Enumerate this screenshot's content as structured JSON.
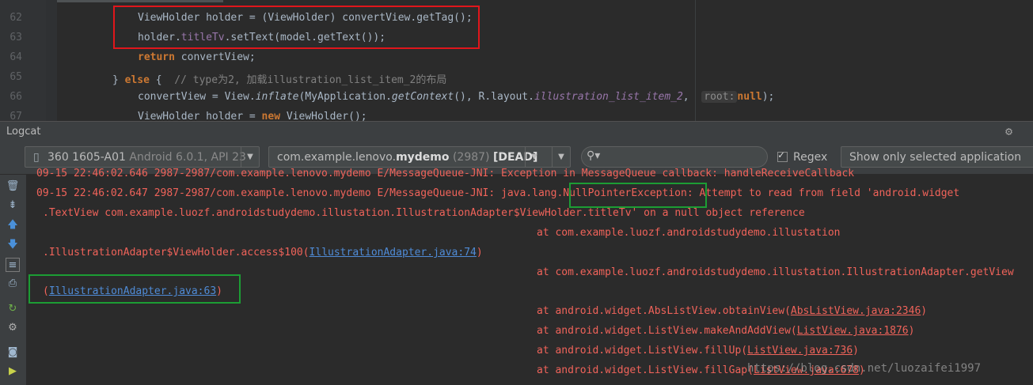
{
  "editor": {
    "lines": [
      {
        "num": "62",
        "code": "ViewHolder holder = (ViewHolder) convertView.getTag();"
      },
      {
        "num": "63",
        "pre": "holder.",
        "field": "titleTv",
        "post": ".setText(model.getText());"
      },
      {
        "num": "64",
        "kw": "return",
        "post": " convertView;"
      },
      {
        "num": "65",
        "pre": "} ",
        "kw": "else",
        "post": " {  ",
        "comment": "// type为2, 加载illustration_list_item_2的布局"
      },
      {
        "num": "66",
        "pre": "convertView = View.",
        "italic": "inflate",
        "mid": "(MyApplication.",
        "italic2": "getContext",
        "mid2": "(), R.layout.",
        "field_italic": "illustration_list_item_2",
        "mid3": ",  ",
        "hint": "root:",
        "kw": "null",
        "post": ");"
      },
      {
        "num": "67",
        "pre": "ViewHolder holder = ",
        "kw": "new",
        "post": " ViewHolder();"
      }
    ]
  },
  "logcat": {
    "title": "Logcat",
    "device": {
      "name": "360 1605-A01",
      "detail": " Android 6.0.1, API 23"
    },
    "process": {
      "prefix": "com.example.lenovo.",
      "bold": "mydemo",
      "pid": " (2987) ",
      "state": "[DEAD]"
    },
    "search": {
      "value": ""
    },
    "regex_label": "Regex",
    "filter": "Show only selected application"
  },
  "log": {
    "line0": "09-15 22:46:02.646 2987-2987/com.example.lenovo.mydemo E/MessageQueue-JNI: Exception in MessageQueue callback: handleReceiveCallback",
    "line1_pre": "09-15 22:46:02.647 2987-2987/com.example.lenovo.mydemo E/MessageQueue-JNI: java.lang.",
    "line1_exc": "NullPointerException",
    "line1_post": ": Attempt to read from field 'android.widget",
    "line2": ".TextView com.example.luozf.androidstudydemo.illustation.IllustrationAdapter$ViewHolder.titleTv' on a null object reference",
    "line3": "at com.example.luozf.androidstudydemo.illustation",
    "line4_pre": ".IllustrationAdapter$ViewHolder.access$100(",
    "line4_link": "IllustrationAdapter.java:74",
    "line4_post": ")",
    "line5": "at com.example.luozf.androidstudydemo.illustation.IllustrationAdapter.getView",
    "line6_pre": "(",
    "line6_link": "IllustrationAdapter.java:63",
    "line6_post": ")",
    "line7_pre": "at android.widget.AbsListView.obtainView(",
    "line7_link": "AbsListView.java:2346",
    "line7_post": ")",
    "line8_pre": "at android.widget.ListView.makeAndAddView(",
    "line8_link": "ListView.java:1876",
    "line8_post": ")",
    "line9_pre": "at android.widget.ListView.fillUp(",
    "line9_link": "ListView.java:736",
    "line9_post": ")",
    "line10_pre": "at android.widget.ListView.fillGap(",
    "line10_link": "ListView.java:678",
    "line10_post": ")"
  },
  "watermark": "https://blog.csdn.net/luozaifei1997",
  "colors": {
    "error": "#f0635a",
    "link": "#4f8bd6",
    "highlight_red": "#e0161b",
    "highlight_green": "#1c9d34"
  }
}
